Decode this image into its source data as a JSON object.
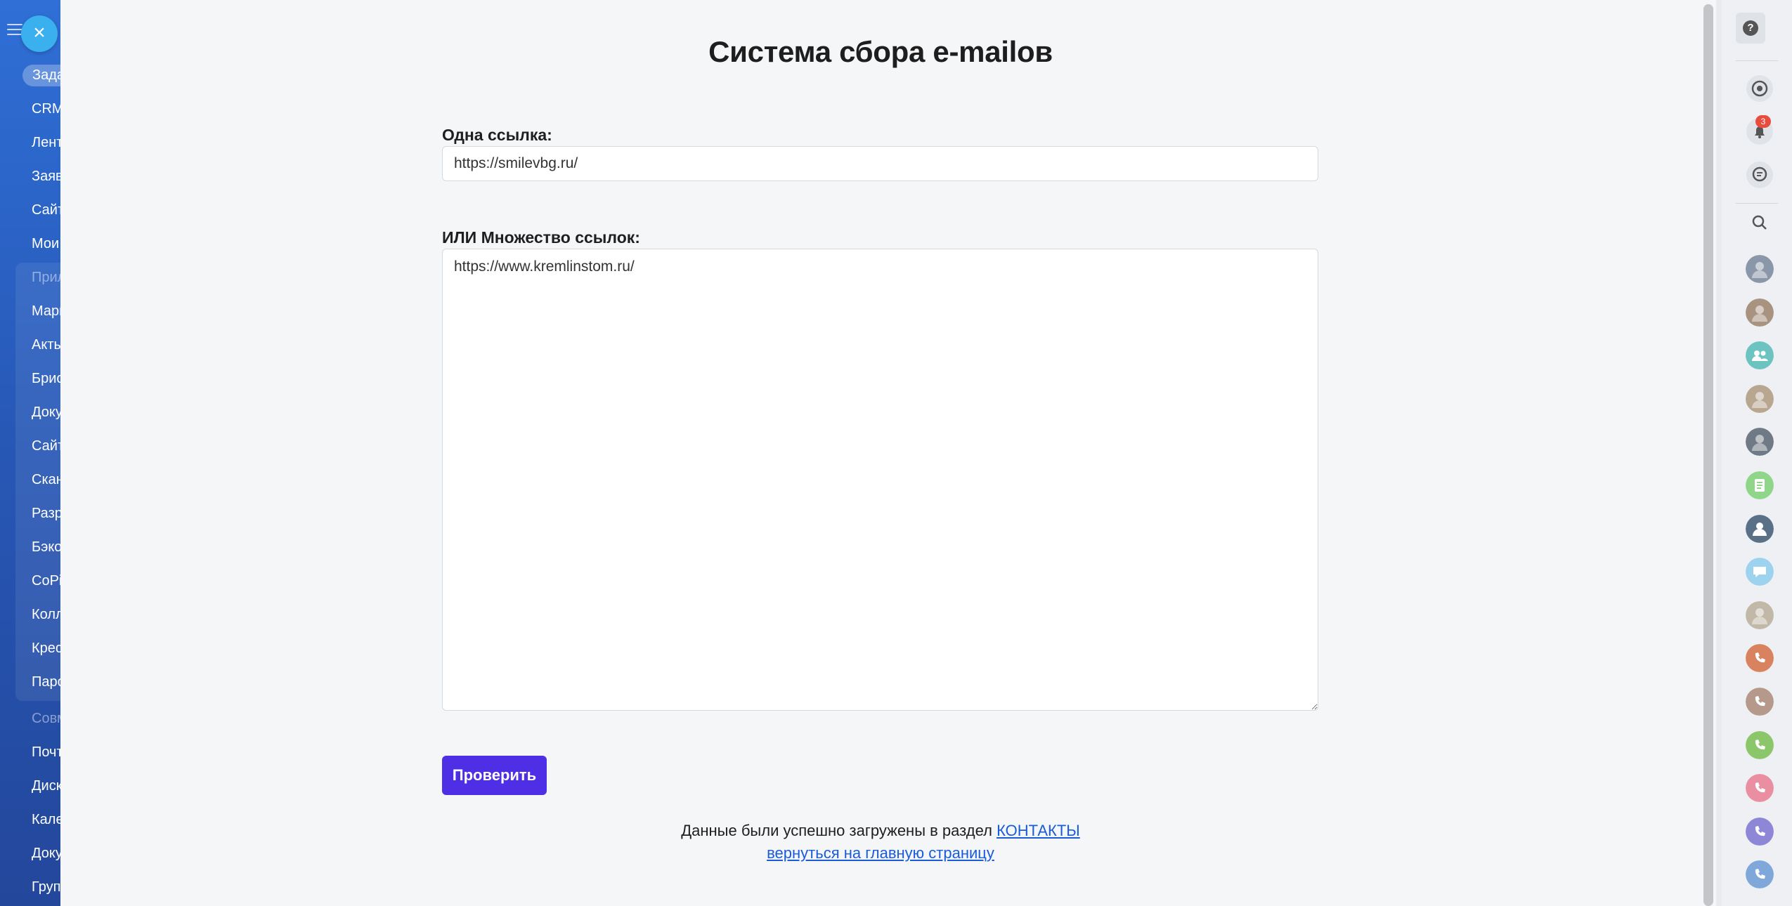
{
  "sidebar": {
    "items": [
      {
        "label": "Задачи",
        "style": "pill"
      },
      {
        "label": "CRM"
      },
      {
        "label": "Лента"
      },
      {
        "label": "Заявки"
      },
      {
        "label": "Сайты"
      },
      {
        "label": "Мои"
      },
      {
        "label": "Приложения",
        "style": "dim"
      },
      {
        "label": "Маркет"
      },
      {
        "label": "Акты"
      },
      {
        "label": "Брис"
      },
      {
        "label": "Доку"
      },
      {
        "label": "Сайт"
      },
      {
        "label": "Скан"
      },
      {
        "label": "Разр"
      },
      {
        "label": "Бэко"
      },
      {
        "label": "CoPi"
      },
      {
        "label": "Колл"
      },
      {
        "label": "Крес"
      },
      {
        "label": "Паро"
      },
      {
        "label": "Совм",
        "style": "dim"
      },
      {
        "label": "Почт"
      },
      {
        "label": "Диск"
      },
      {
        "label": "Кале"
      },
      {
        "label": "Доку"
      },
      {
        "label": "Груп"
      }
    ]
  },
  "close_icon": "×",
  "page": {
    "title": "Система сбора e-mailов",
    "single_link_label": "Одна ссылка:",
    "single_link_value": "https://smilevbg.ru/",
    "multi_link_label": "ИЛИ Множество ссылок:",
    "multi_link_value": "https://www.kremlinstom.ru/",
    "submit_label": "Проверить",
    "status_text": "Данные были успешно загружены в раздел ",
    "status_link": "КОНТАКТЫ",
    "back_link": "вернуться на главную страницу"
  },
  "rightbar": {
    "notification_count": "3",
    "icons": [
      "help-icon",
      "copilot-icon",
      "bell-icon",
      "chat-icon",
      "search-icon"
    ],
    "contacts": [
      {
        "kind": "avatar",
        "color": "#8a97a8"
      },
      {
        "kind": "avatar",
        "color": "#a89280"
      },
      {
        "kind": "group",
        "color": "#6cc3bf"
      },
      {
        "kind": "avatar",
        "color": "#b9a690"
      },
      {
        "kind": "avatar",
        "color": "#6f7a86"
      },
      {
        "kind": "doc",
        "color": "#8fd68a"
      },
      {
        "kind": "user",
        "color": "#5a7087"
      },
      {
        "kind": "chat",
        "color": "#9ed3f0"
      },
      {
        "kind": "avatar",
        "color": "#c2b8a8"
      },
      {
        "kind": "phone",
        "color": "#d9825f"
      },
      {
        "kind": "phone",
        "color": "#b59a8c"
      },
      {
        "kind": "phone",
        "color": "#8bc66a"
      },
      {
        "kind": "phone",
        "color": "#ea8fa2"
      },
      {
        "kind": "phone",
        "color": "#8e86d6"
      },
      {
        "kind": "phone",
        "color": "#7fa7d9"
      }
    ]
  },
  "colors": {
    "primary_button": "#4f2fe6",
    "link": "#1a5cd8",
    "sidebar": "#2f63c4"
  }
}
